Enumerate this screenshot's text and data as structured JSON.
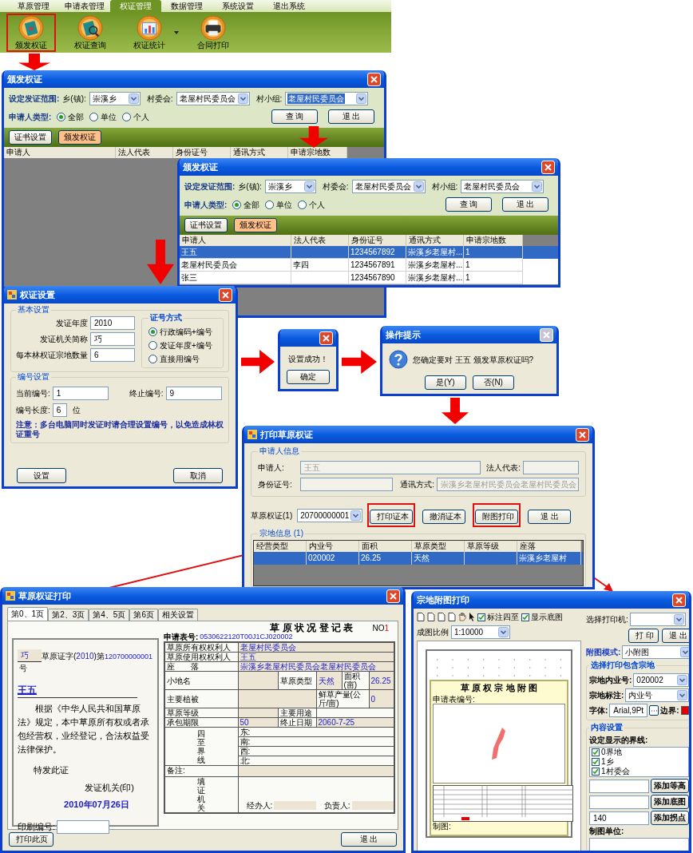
{
  "ribbon": {
    "tabs": [
      {
        "label": "草原管理",
        "selected": false
      },
      {
        "label": "申请表管理",
        "selected": false
      },
      {
        "label": "权证管理",
        "selected": true
      },
      {
        "label": "数据管理",
        "selected": false
      },
      {
        "label": "系统设置",
        "selected": false
      },
      {
        "label": "退出系统",
        "selected": false
      }
    ],
    "tools": [
      {
        "label": "颁发权证",
        "kind": "book",
        "highlighted": true,
        "has_menu": false
      },
      {
        "label": "权证查询",
        "kind": "search",
        "highlighted": false,
        "has_menu": false
      },
      {
        "label": "权证统计",
        "kind": "chart",
        "highlighted": false,
        "has_menu": true
      },
      {
        "label": "合同打印",
        "kind": "printer",
        "highlighted": false,
        "has_menu": false
      }
    ]
  },
  "issue_windows": [
    {
      "title": "颁发权证",
      "scope_label": "设定发证范围:",
      "town_label": "乡(镇):",
      "town": "崇溪乡",
      "committee_label": "村委会:",
      "committee": "老屋村民委员会",
      "group_label": "村小组:",
      "group": "老屋村民委员会",
      "group_focused": true,
      "type_label": "申请人类型:",
      "applicant_types": [
        {
          "label": "全部",
          "selected": true
        },
        {
          "label": "单位",
          "selected": false
        },
        {
          "label": "个人",
          "selected": false
        }
      ],
      "buttons": [
        "查 询",
        "退 出"
      ],
      "toolbar": [
        {
          "label": "证书设置",
          "kind": "plain"
        },
        {
          "label": "颁发权证",
          "kind": "accent"
        }
      ],
      "columns": [
        "申请人",
        "法人代表",
        "身份证号",
        "通讯方式",
        "申请宗地数"
      ]
    },
    {
      "title": "颁发权证",
      "scope_label": "设定发证范围:",
      "town_label": "乡(镇):",
      "town": "崇溪乡",
      "committee_label": "村委会:",
      "committee": "老屋村民委员会",
      "group_label": "村小组:",
      "group": "老屋村民委员会",
      "group_focused": false,
      "type_label": "申请人类型:",
      "applicant_types": [
        {
          "label": "全部",
          "selected": true
        },
        {
          "label": "单位",
          "selected": false
        },
        {
          "label": "个人",
          "selected": false
        }
      ],
      "buttons": [
        "查 询",
        "退 出"
      ],
      "toolbar": [
        {
          "label": "证书设置",
          "kind": "plain"
        },
        {
          "label": "颁发权证",
          "kind": "accent"
        }
      ],
      "columns": [
        "申请人",
        "法人代表",
        "身份证号",
        "通讯方式",
        "申请宗地数"
      ],
      "rows": [
        {
          "selected": true,
          "applicant": "王五",
          "id_no": "1234567892",
          "contact": "崇溪乡老屋村...",
          "parcels": "1"
        },
        {
          "selected": false,
          "applicant": "老屋村民委员会",
          "legal_rep": "李四",
          "id_no": "1234567891",
          "contact": "崇溪乡老屋村...",
          "parcels": "1"
        },
        {
          "selected": false,
          "applicant": "张三",
          "id_no": "1234567890",
          "contact": "崇溪乡老屋村...",
          "parcels": "1"
        }
      ]
    }
  ],
  "settings": {
    "title": "权证设置",
    "basic_legend": "基本设置",
    "fields": [
      {
        "label": "发证年度",
        "value": "2010"
      },
      {
        "label": "发证机关简称",
        "value": "巧"
      },
      {
        "label": "每本林权证宗地数量",
        "value": "6"
      }
    ],
    "mode_legend": "证号方式",
    "modes": [
      {
        "label": "行政编码+编号",
        "selected": true
      },
      {
        "label": "发证年度+编号",
        "selected": false
      },
      {
        "label": "直接用编号",
        "selected": false
      }
    ],
    "numbering_legend": "编号设置",
    "current_label": "当前编号:",
    "current": "1",
    "end_label": "终止编号:",
    "end": "9",
    "length_label": "编号长度:",
    "length": "6",
    "unit": "位",
    "note": "注意：多台电脑同时发证时请合理设置编号，以免造成林权证重号",
    "buttons": [
      "设置",
      "取消"
    ]
  },
  "success_dialog": {
    "message": "设置成功！",
    "button": "确定"
  },
  "confirm_dialog": {
    "title": "操作提示",
    "close_disabled": true,
    "message": "您确定要对 王五 颁发草原权证吗?",
    "buttons": [
      "是(Y)",
      "否(N)"
    ]
  },
  "print_window": {
    "title": "打印草原权证",
    "info_legend": "申请人信息",
    "info_disabled": true,
    "applicant_label": "申请人:",
    "applicant": "王五",
    "legal_rep_label": "法人代表:",
    "id_label": "身份证号:",
    "contact_label": "通讯方式:",
    "contact": "崇溪乡老屋村民委员会老屋村民委员会",
    "cert_label": "草原权证(1)",
    "cert": "20700000001",
    "buttons": [
      {
        "label": "打印证本",
        "highlighted": true
      },
      {
        "label": "撤消证本",
        "highlighted": false
      },
      {
        "label": "附图打印",
        "highlighted": true
      },
      {
        "label": "退 出",
        "highlighted": false
      }
    ],
    "parcel_legend": "宗地信息 (1)",
    "columns": [
      "经营类型",
      "内业号",
      "面积",
      "草原类型",
      "草原等级",
      "座落"
    ],
    "rows": [
      {
        "selected": true,
        "parcel_no": "020002",
        "area": "26.25",
        "grass_type": "天然",
        "location": "崇溪乡老屋村"
      }
    ]
  },
  "cert_print": {
    "title": "草原权证打印",
    "tabs": [
      {
        "label": "第0、1页",
        "selected": true
      },
      {
        "label": "第2、3页",
        "selected": false
      },
      {
        "label": "第4、5页",
        "selected": false
      },
      {
        "label": "第6页",
        "selected": false
      },
      {
        "label": "相关设置",
        "selected": false
      }
    ],
    "org": "巧",
    "word_prefix": "草原证字(",
    "year": "2010",
    "word_mid": ")第",
    "number": "120700000001",
    "word_suffix": "号",
    "holder": "王五",
    "body": "根据《中华人民共和国草原法》规定，本中草原所有权或者承包经营权，业经登记，合法权益受法律保护。",
    "issue": "特发此证",
    "authority": "发证机关(印)",
    "date": "2010年07月26日",
    "print_no_label": "印刷编号:",
    "print_page_button": "打印此页",
    "form": {
      "title": "草 原 状 况 登 记 表",
      "no_label": "NO",
      "no": "1",
      "app_no_label": "申请表号:",
      "app_no": "0530622120T00J1CJ020002",
      "owner_label": "草原所有权权利人",
      "owner": "老屋村民委员会",
      "user_label": "草原使用权权利人",
      "user": "王五",
      "location_label": "座　　落",
      "location": "崇溪乡老屋村民委员会老屋村民委员会",
      "place_label": "小地名",
      "type_label": "草原类型",
      "type": "天然",
      "area_label": "面积(亩)",
      "area": "26.25",
      "veg_label": "主要植被",
      "yield_label": "鲜草产量(公斤/亩)",
      "yield": "0",
      "grade_label": "草原等级",
      "use_label": "主要用途",
      "term_label": "承包期限",
      "term": "50",
      "end_label": "终止日期",
      "end": "2060-7-25",
      "bounds_label": "四至界线",
      "bounds": [
        "东:",
        "南:",
        "西:",
        "北:"
      ],
      "remark_label": "备注:",
      "issuer_label": "填证机关",
      "handler_label": "经办人:",
      "chief_label": "负责人:"
    },
    "exit_button": "退 出"
  },
  "map_print": {
    "title": "宗地附图打印",
    "checks": [
      {
        "label": "标注四至",
        "checked": true
      },
      {
        "label": "显示底图",
        "checked": true
      }
    ],
    "scale_label": "成图比例",
    "scale": "1:10000",
    "sheet_title": "草 原 权 宗 地 附 图",
    "sheet_app_no_label": "申请表编号:",
    "sheet_drawer_label": "制图:",
    "printer_label": "选择打印机:",
    "buttons": [
      "打 印",
      "退 出"
    ],
    "mode_label": "附图模式:",
    "mode": "小附图",
    "parcel_legend": "选择打印包含宗地",
    "parcel_no_label": "宗地内业号:",
    "parcel_no": "020002",
    "marker_label": "宗地标注:",
    "marker": "内业号",
    "font_label": "字体:",
    "font": "Arial,9Pt",
    "border_label": "边界:",
    "content_legend": "内容设置",
    "lines_label": "设定显示的界线:",
    "lines": [
      {
        "label": "0界地",
        "checked": true
      },
      {
        "label": "1乡",
        "checked": true
      },
      {
        "label": "1村委会",
        "checked": true
      }
    ],
    "adders": [
      {
        "button": "添加等高"
      },
      {
        "button": "添加底图"
      },
      {
        "value": "140",
        "button": "添加拐点"
      }
    ],
    "unit_label": "制图单位:"
  }
}
